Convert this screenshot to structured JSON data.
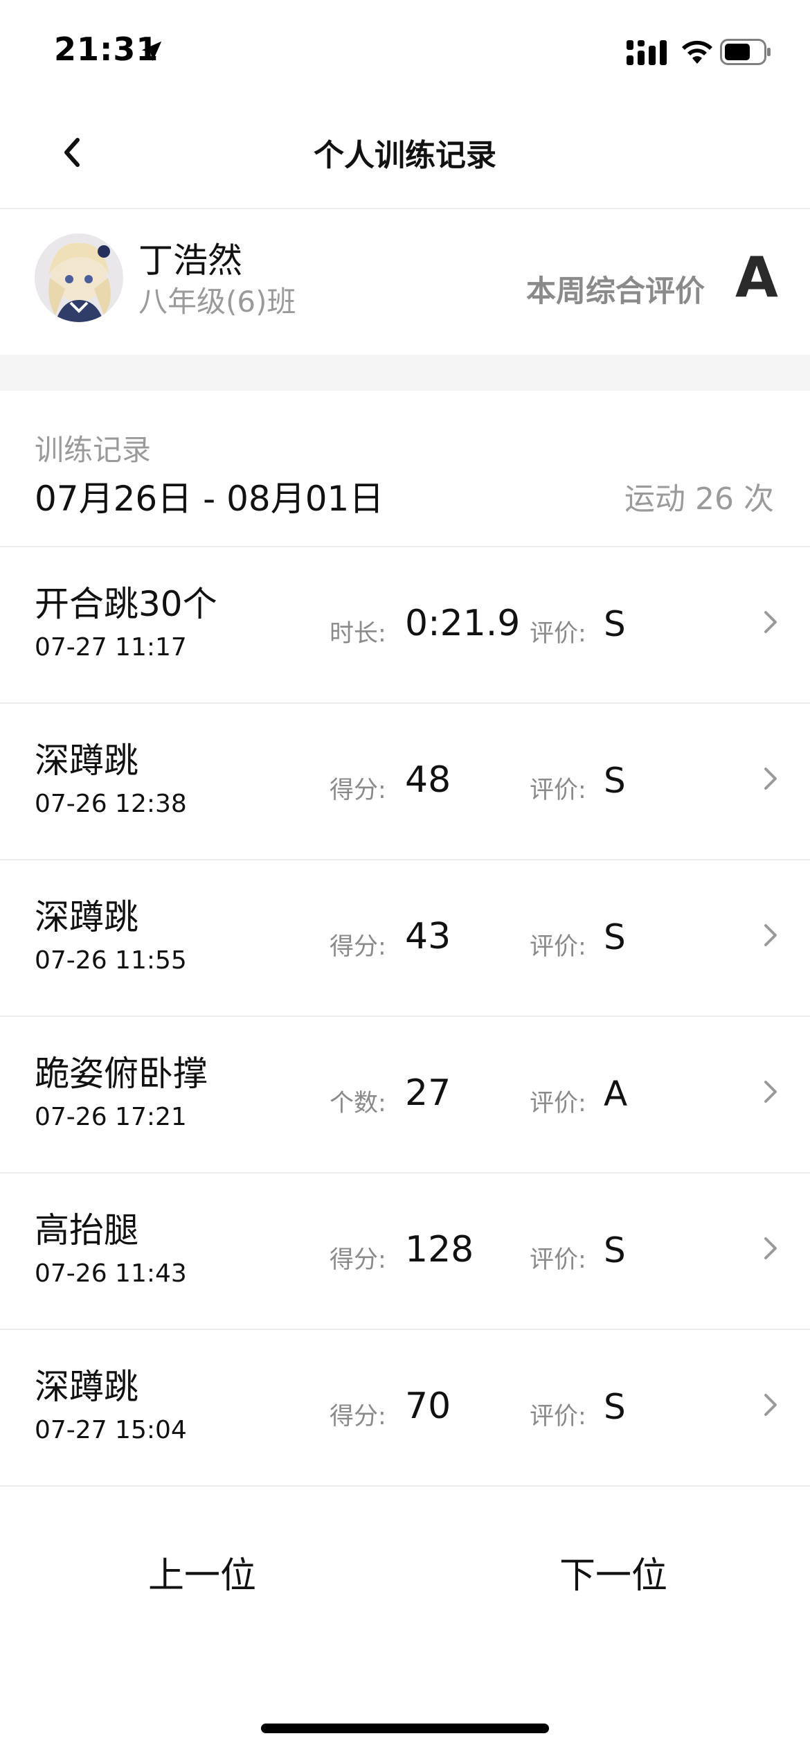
{
  "status_bar": {
    "time": "21:31",
    "icons": [
      "location-arrow-icon",
      "cellular-signal-icon",
      "wifi-icon",
      "battery-icon"
    ]
  },
  "nav": {
    "title": "个人训练记录",
    "back_icon": "chevron-left-icon"
  },
  "student": {
    "name": "丁浩然",
    "class_name": "八年级(6)班",
    "weekly_label": "本周综合评价",
    "weekly_grade": "A"
  },
  "records": {
    "label": "训练记录",
    "range": "07月26日 - 08月01日",
    "count_text": "运动 26 次",
    "items": [
      {
        "name": "开合跳30个",
        "time": "07-27 11:17",
        "metric_label": "时长:",
        "metric_value": "0:21.9",
        "grade_label": "评价:",
        "grade": "S"
      },
      {
        "name": "深蹲跳",
        "time": "07-26 12:38",
        "metric_label": "得分:",
        "metric_value": "48",
        "grade_label": "评价:",
        "grade": "S"
      },
      {
        "name": "深蹲跳",
        "time": "07-26 11:55",
        "metric_label": "得分:",
        "metric_value": "43",
        "grade_label": "评价:",
        "grade": "S"
      },
      {
        "name": "跪姿俯卧撑",
        "time": "07-26 17:21",
        "metric_label": "个数:",
        "metric_value": "27",
        "grade_label": "评价:",
        "grade": "A"
      },
      {
        "name": "高抬腿",
        "time": "07-26 11:43",
        "metric_label": "得分:",
        "metric_value": "128",
        "grade_label": "评价:",
        "grade": "S"
      },
      {
        "name": "深蹲跳",
        "time": "07-27 15:04",
        "metric_label": "得分:",
        "metric_value": "70",
        "grade_label": "评价:",
        "grade": "S"
      }
    ]
  },
  "footer": {
    "prev_label": "上一位",
    "next_label": "下一位"
  }
}
